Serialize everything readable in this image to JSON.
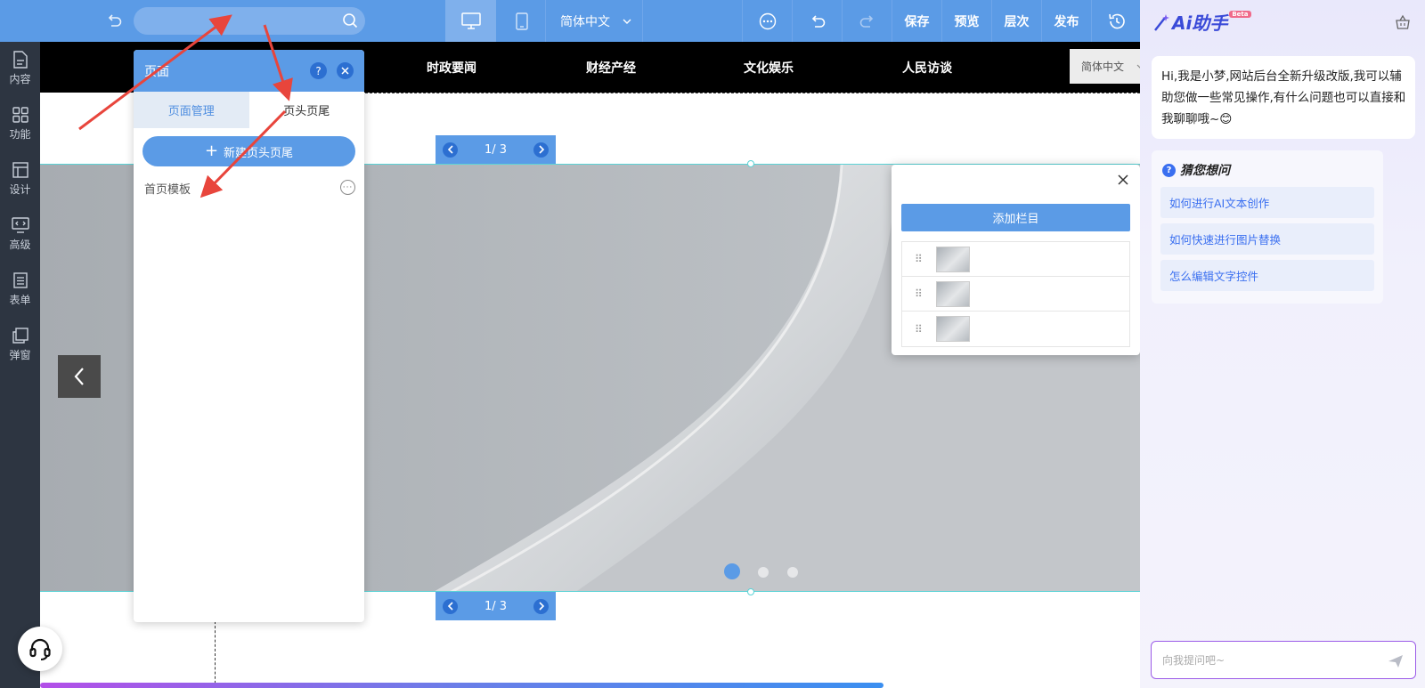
{
  "toolbar": {
    "search_placeholder": "",
    "lang_label": "简体中文",
    "save_label": "保存",
    "preview_label": "预览",
    "layers_label": "层次",
    "publish_label": "发布"
  },
  "rail": {
    "items": [
      {
        "label": "内容",
        "icon": "document-icon"
      },
      {
        "label": "功能",
        "icon": "grid-icon"
      },
      {
        "label": "设计",
        "icon": "layout-icon"
      },
      {
        "label": "高级",
        "icon": "code-monitor-icon"
      },
      {
        "label": "表单",
        "icon": "form-icon"
      },
      {
        "label": "弹窗",
        "icon": "popup-icon"
      }
    ]
  },
  "site": {
    "nav_links": [
      "时政要闻",
      "财经产经",
      "文化娱乐",
      "人民访谈"
    ],
    "lang_select": "简体中文",
    "pager_top": "1/ 3",
    "pager_bottom": "1/ 3"
  },
  "panel": {
    "title": "页面",
    "help": "?",
    "tabs": [
      "页面管理",
      "页头页尾"
    ],
    "new_button": "新建页头页尾",
    "template_name": "首页模板"
  },
  "slides": {
    "add_button": "添加栏目",
    "count": 3
  },
  "ai": {
    "title": "Ai助手",
    "beta": "Beta",
    "greeting": "Hi,我是小梦,网站后台全新升级改版,我可以辅助您做一些常见操作,有什么问题也可以直接和我聊聊哦~😊",
    "guess_title": "猜您想问",
    "suggestions": [
      "如何进行AI文本创作",
      "如何快速进行图片替换",
      "怎么编辑文字控件"
    ],
    "input_placeholder": "向我提问吧~"
  },
  "colors": {
    "toolbar_blue": "#5b9be6",
    "rail_dark": "#2d3541",
    "annotation_red": "#e8453c"
  }
}
